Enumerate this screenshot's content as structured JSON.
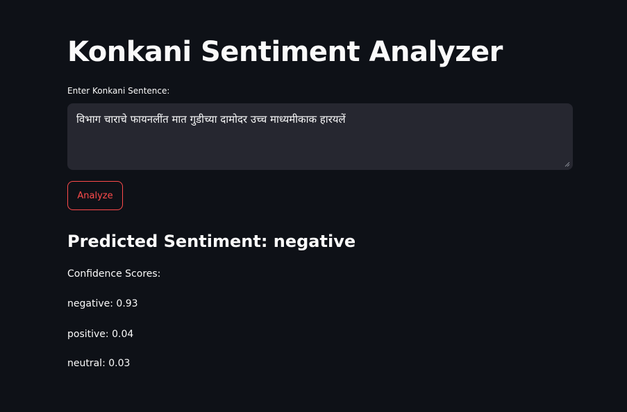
{
  "page": {
    "title": "Konkani Sentiment Analyzer",
    "accent_color": "#ff4b4b",
    "background_color": "#0e1117"
  },
  "input": {
    "label": "Enter Konkani Sentence:",
    "value": "विभाग चाराचे फायनलींत मात गुडीच्या दामोदर उच्च माध्यमीकाक हारयलें"
  },
  "actions": {
    "analyze_label": "Analyze"
  },
  "result": {
    "prefix": "Predicted Sentiment: ",
    "sentiment": "negative",
    "confidence_label": "Confidence Scores:",
    "scores": [
      {
        "label": "negative",
        "value": "0.93"
      },
      {
        "label": "positive",
        "value": "0.04"
      },
      {
        "label": "neutral",
        "value": "0.03"
      }
    ]
  }
}
